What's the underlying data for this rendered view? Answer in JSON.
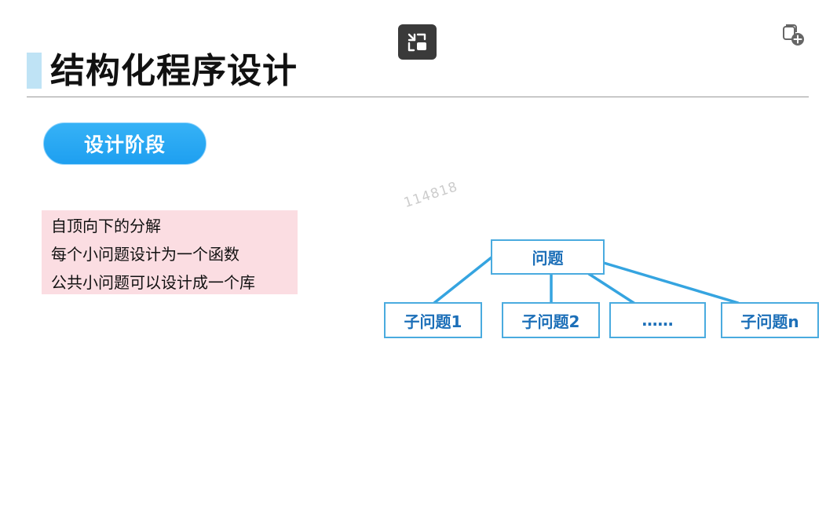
{
  "toolbar": {
    "exit_fullscreen_icon": "exit-fullscreen-icon",
    "add_collection_icon": "add-to-collection-icon"
  },
  "slide": {
    "title": "结构化程序设计",
    "stage_label": "设计阶段",
    "steps": [
      "自顶向下的分解",
      "每个小问题设计为一个函数",
      "公共小问题可以设计成一个库"
    ],
    "watermark": "114818"
  },
  "tree": {
    "root": "问题",
    "children": [
      "子问题1",
      "子问题2",
      "……",
      "子问题n"
    ]
  },
  "colors": {
    "accent": "#1e9ff0",
    "node_border": "#4aabdf",
    "node_text": "#1c6fb8",
    "steps_bg": "#fbdde2"
  }
}
